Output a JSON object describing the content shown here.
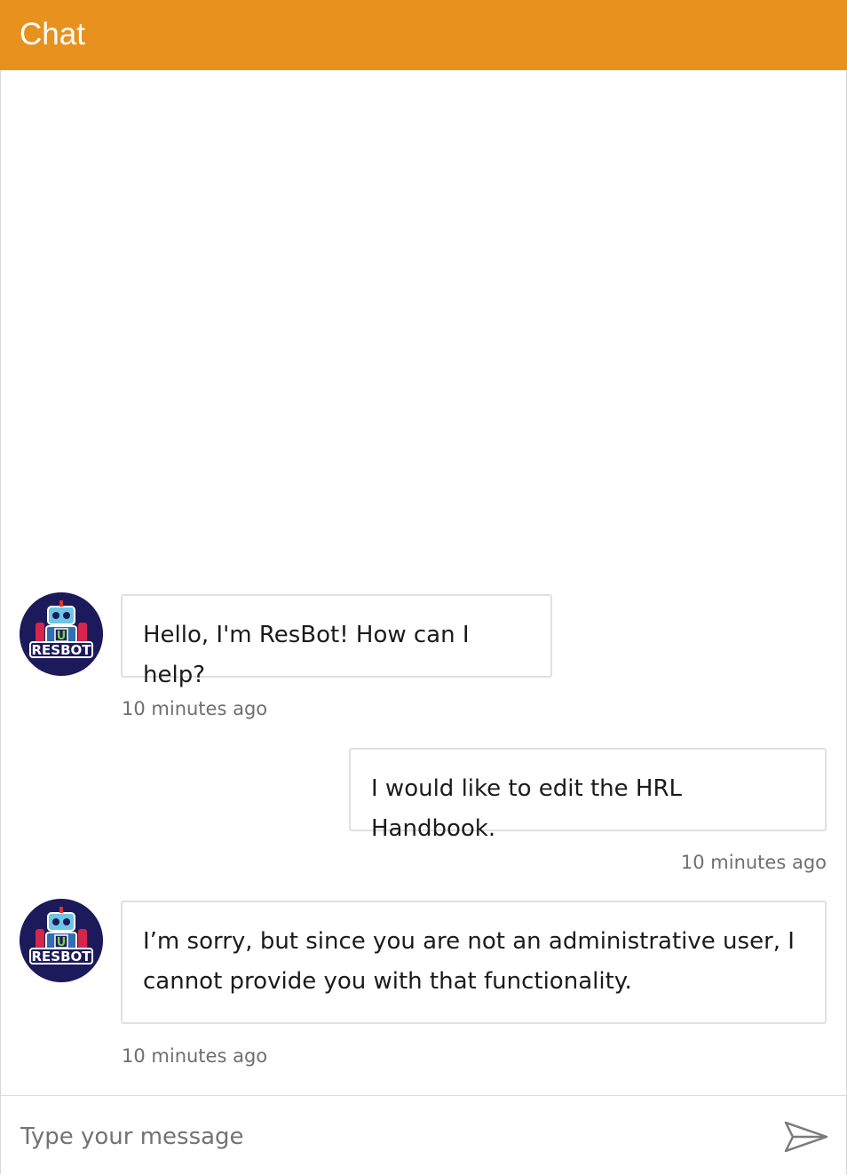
{
  "header": {
    "title": "Chat"
  },
  "messages": [
    {
      "sender": "bot",
      "avatar": "resbot-avatar",
      "text": "Hello, I'm ResBot! How can I help?",
      "time": "10 minutes ago"
    },
    {
      "sender": "user",
      "text": "I would like to edit the HRL Handbook.",
      "time": "10 minutes ago"
    },
    {
      "sender": "bot",
      "avatar": "resbot-avatar",
      "text": "I’m sorry, but since you are not an administrative user, I cannot provide you with that functionality.",
      "time": "10 minutes ago"
    }
  ],
  "composer": {
    "placeholder": "Type your message",
    "send_icon": "send-icon"
  },
  "colors": {
    "header": "#e7921f",
    "avatar_bg": "#1c1a5a"
  }
}
